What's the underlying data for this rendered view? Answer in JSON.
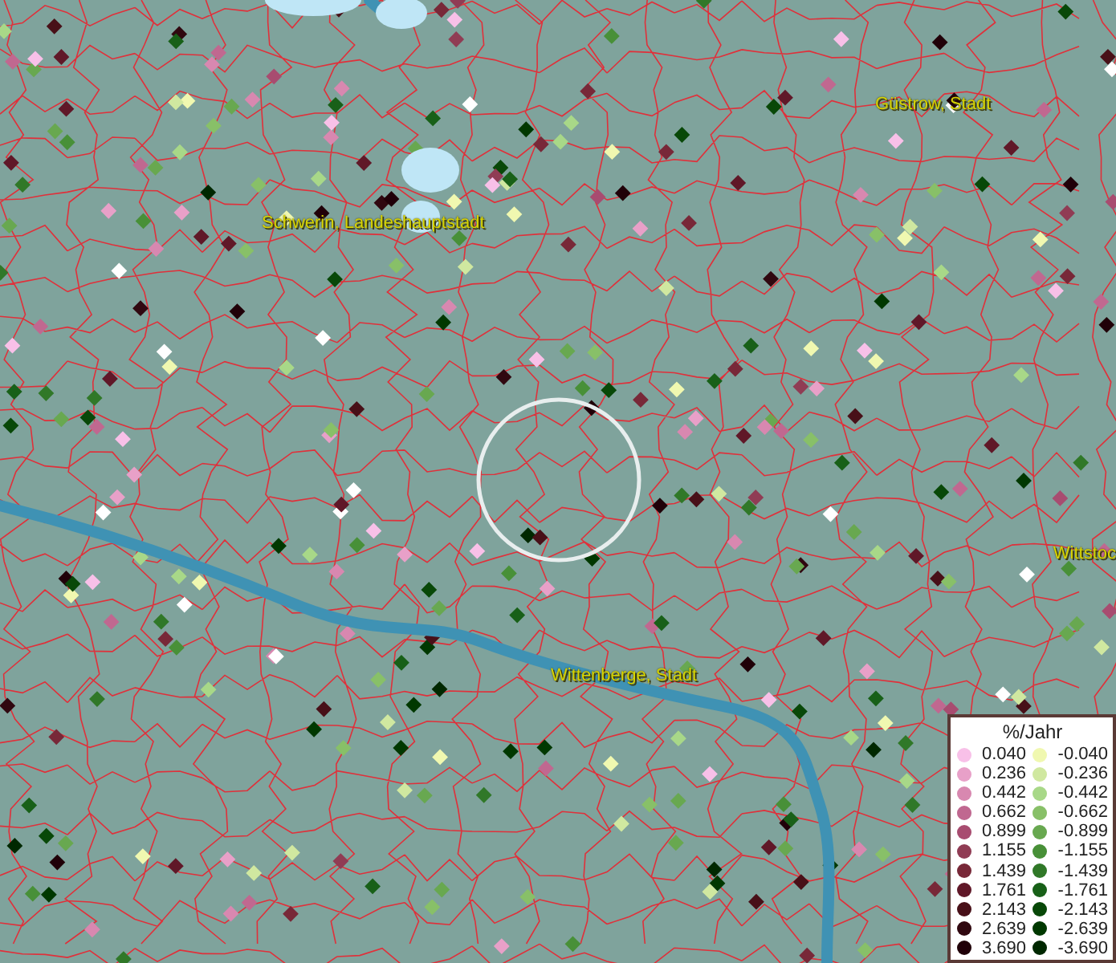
{
  "cities": [
    {
      "name": "Schwerin, Landeshauptstadt"
    },
    {
      "name": "Güstrow, Stadt"
    },
    {
      "name": "Wittenberge, Stadt"
    },
    {
      "name": "Wittstoc"
    }
  ],
  "legend": {
    "title": "%/Jahr",
    "positive": [
      {
        "label": "0.040",
        "color": "#f8c0e8"
      },
      {
        "label": "0.236",
        "color": "#e8a0c8"
      },
      {
        "label": "0.442",
        "color": "#d888b0"
      },
      {
        "label": "0.662",
        "color": "#c06890"
      },
      {
        "label": "0.899",
        "color": "#a84c70"
      },
      {
        "label": "1.155",
        "color": "#903c54"
      },
      {
        "label": "1.439",
        "color": "#782838"
      },
      {
        "label": "1.761",
        "color": "#601828"
      },
      {
        "label": "2.143",
        "color": "#481018"
      },
      {
        "label": "2.639",
        "color": "#300810"
      },
      {
        "label": "3.690",
        "color": "#200008"
      }
    ],
    "negative": [
      {
        "label": "-0.040",
        "color": "#f0f8b0"
      },
      {
        "label": "-0.236",
        "color": "#d0e8a0"
      },
      {
        "label": "-0.442",
        "color": "#a8d888"
      },
      {
        "label": "-0.662",
        "color": "#88c068"
      },
      {
        "label": "-0.899",
        "color": "#68a850"
      },
      {
        "label": "-1.155",
        "color": "#489038"
      },
      {
        "label": "-1.439",
        "color": "#307828"
      },
      {
        "label": "-1.761",
        "color": "#186018"
      },
      {
        "label": "-2.143",
        "color": "#084808"
      },
      {
        "label": "-2.639",
        "color": "#003800"
      },
      {
        "label": "-3.690",
        "color": "#002800"
      }
    ]
  }
}
